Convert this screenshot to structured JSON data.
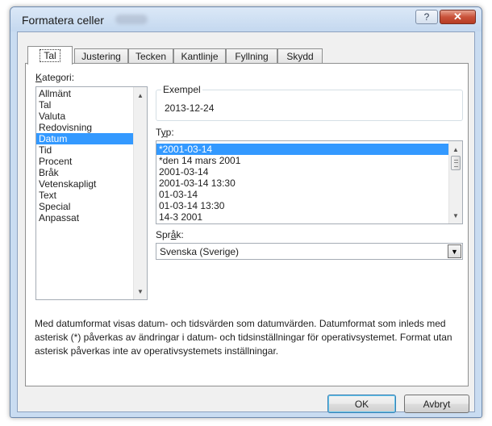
{
  "dialog": {
    "title": "Formatera celler",
    "help_label": "?",
    "close_label": "✕"
  },
  "tabs": [
    {
      "label": "Tal"
    },
    {
      "label": "Justering"
    },
    {
      "label": "Tecken"
    },
    {
      "label": "Kantlinje"
    },
    {
      "label": "Fyllning"
    },
    {
      "label": "Skydd"
    }
  ],
  "category": {
    "label_u": "K",
    "label_rest": "ategori:",
    "items": [
      "Allmänt",
      "Tal",
      "Valuta",
      "Redovisning",
      "Datum",
      "Tid",
      "Procent",
      "Bråk",
      "Vetenskapligt",
      "Text",
      "Special",
      "Anpassat"
    ],
    "selected": "Datum"
  },
  "sample": {
    "label": "Exempel",
    "value": "2013-12-24"
  },
  "type": {
    "label_pre": "T",
    "label_u": "y",
    "label_post": "p:",
    "items": [
      "*2001-03-14",
      "*den 14 mars 2001",
      "2001-03-14",
      "2001-03-14 13:30",
      "01-03-14",
      "01-03-14 13:30",
      "14-3 2001"
    ],
    "selected": "*2001-03-14"
  },
  "language": {
    "label_pre": "Spr",
    "label_u": "å",
    "label_post": "k:",
    "value": "Svenska (Sverige)"
  },
  "description": "Med datumformat visas datum- och tidsvärden som datumvärden. Datumformat som inleds med asterisk (*) påverkas av ändringar i datum- och tidsinställningar för operativsystemet. Format utan asterisk påverkas inte av operativsystemets inställningar.",
  "buttons": {
    "ok": "OK",
    "cancel": "Avbryt"
  }
}
